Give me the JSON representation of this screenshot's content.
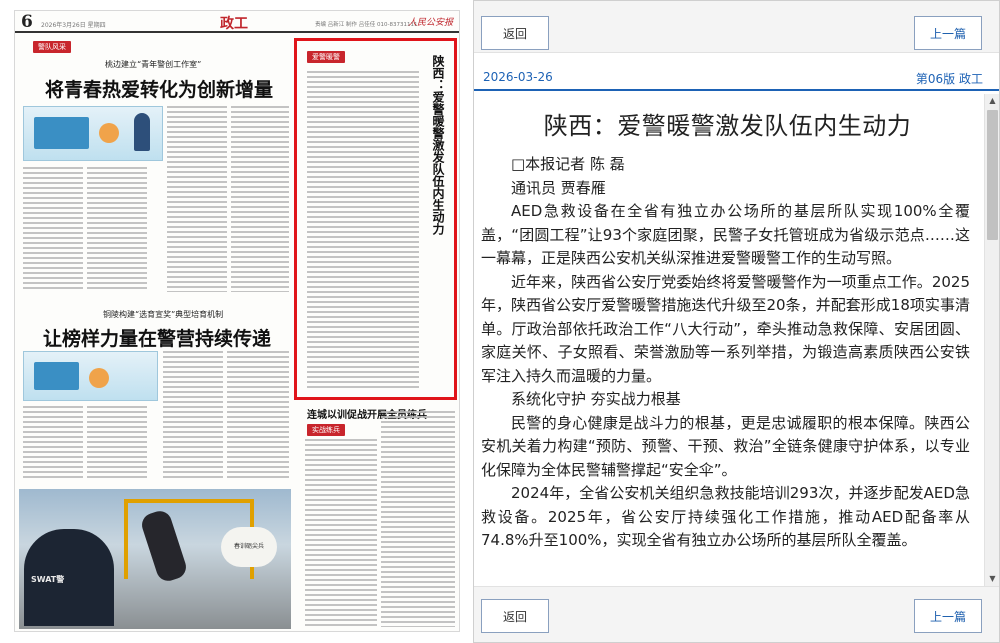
{
  "newspaper": {
    "page_number": "6",
    "page_date": "2026年3月26日 星期四",
    "section_name": "政工",
    "page_meta": "责编 吕新江  制作 吕佳佳  010-83731111",
    "brand": "人民公安报",
    "top_tag": "警队风采",
    "story1_kicker": "桃边建立“青年警创工作室”",
    "story1_headline": "将青春热爱转化为创新增量",
    "story2_kicker": "铜陵构建“选育宣奖”典型培育机制",
    "story2_headline": "让榜样力量在警营持续传递",
    "highlight_tag": "爱警暖警",
    "highlight_title": "陕西：爱警暖警激发队伍内生动力",
    "story3_headline": "连城以训促战开展全员练兵",
    "story3_tag": "实战练兵",
    "photo_badge": "SWAT警",
    "photo_caption": "春训砺尖兵"
  },
  "reader": {
    "back_label": "返回",
    "prev_label": "上一篇",
    "date": "2026-03-26",
    "edition": "第06版 政工",
    "title": "陕西：爱警暖警激发队伍内生动力",
    "paragraphs": [
      "□本报记者 陈 磊",
      "通讯员 贾春雁",
      "AED急救设备在全省有独立办公场所的基层所队实现100%全覆盖，“团圆工程”让93个家庭团聚，民警子女托管班成为省级示范点……这一幕幕，正是陕西公安机关纵深推进爱警暖警工作的生动写照。",
      "近年来，陕西省公安厅党委始终将爱警暖警作为一项重点工作。2025年，陕西省公安厅爱警暖警措施迭代升级至20条，并配套形成18项实事清单。厅政治部依托政治工作“八大行动”，牵头推动急救保障、安居团圆、家庭关怀、子女照看、荣誉激励等一系列举措，为锻造高素质陕西公安铁军注入持久而温暖的力量。",
      "系统化守护 夯实战力根基",
      "民警的身心健康是战斗力的根基，更是忠诚履职的根本保障。陕西公安机关着力构建“预防、预警、干预、救治”全链条健康守护体系，以专业化保障为全体民警辅警撑起“安全伞”。",
      "2024年，全省公安机关组织急救技能培训293次，并逐步配发AED急救设备。2025年，省公安厅持续强化工作措施，推动AED配备率从74.8%升至100%，实现全省有独立办公场所的基层所队全覆盖。"
    ]
  }
}
